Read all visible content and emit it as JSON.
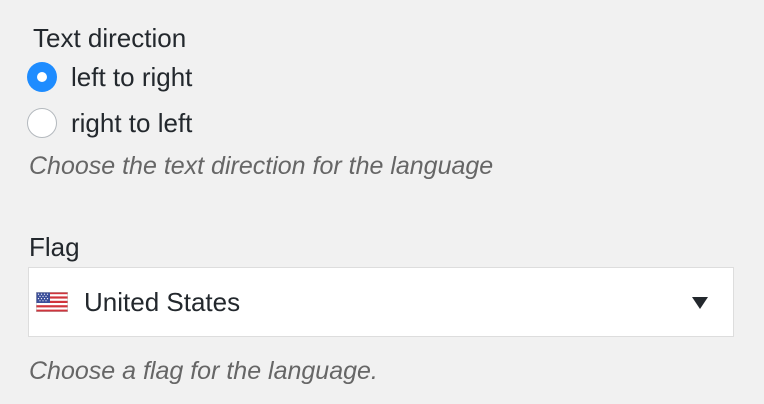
{
  "text_direction": {
    "label": "Text direction",
    "options": [
      {
        "label": "left to right",
        "checked": true
      },
      {
        "label": "right to left",
        "checked": false
      }
    ],
    "help": "Choose the text direction for the language"
  },
  "flag": {
    "label": "Flag",
    "selected": "United States",
    "selected_icon": "us-flag-icon",
    "help": "Choose a flag for the language."
  },
  "colors": {
    "accent": "#1e8cff",
    "background": "#f1f1f1",
    "help_text": "#666666"
  }
}
